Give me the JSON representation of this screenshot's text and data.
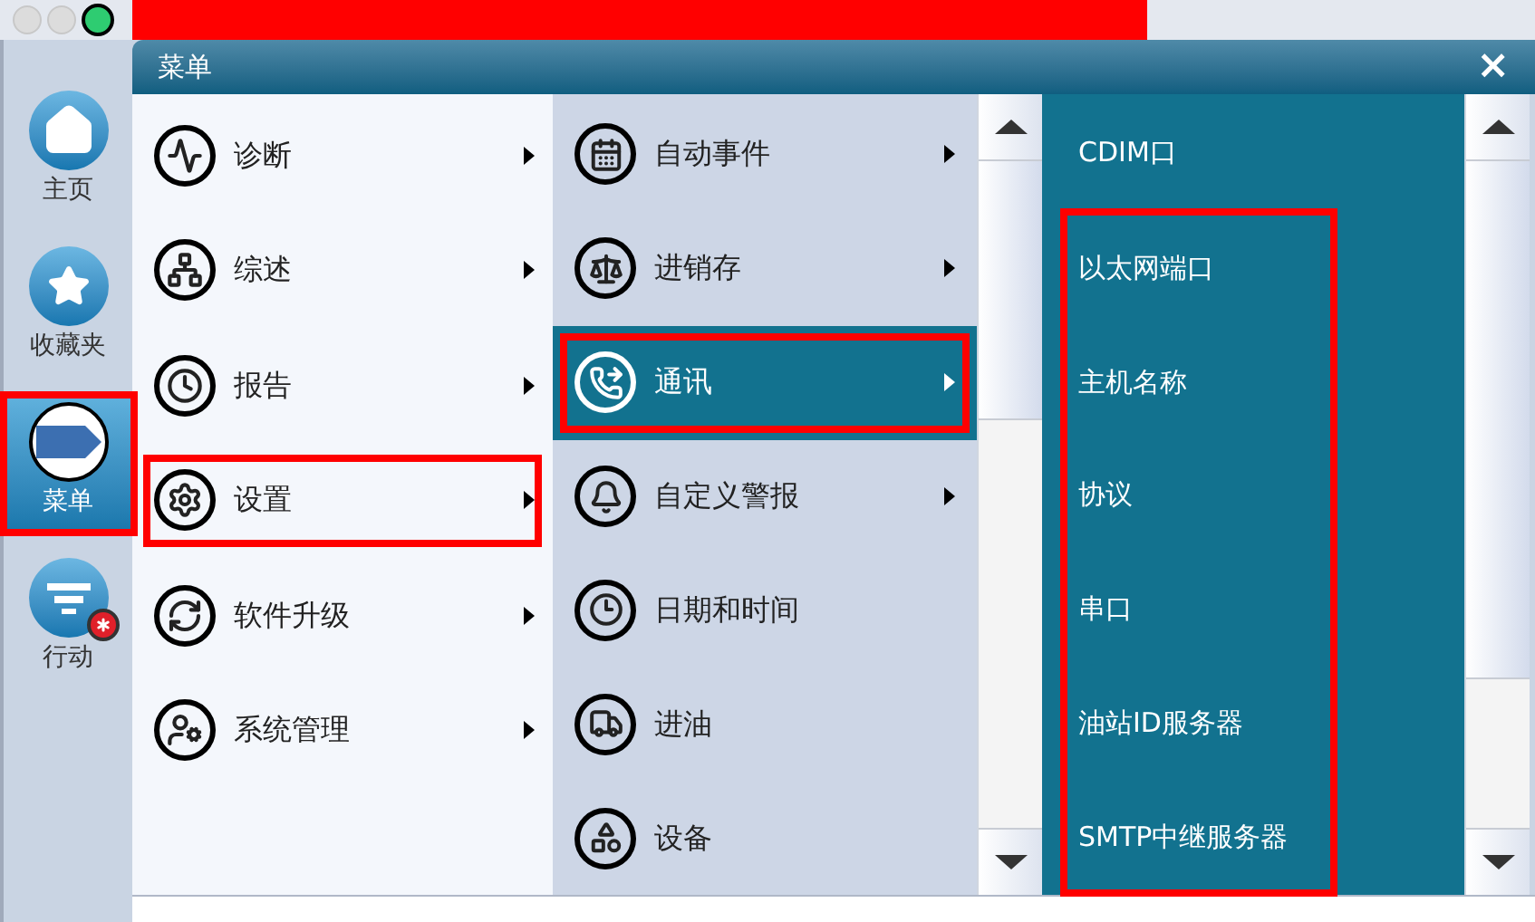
{
  "sidebar": {
    "items": [
      {
        "label": "主页",
        "selected": false,
        "highlighted": false,
        "badge": false
      },
      {
        "label": "收藏夹",
        "selected": false,
        "highlighted": false,
        "badge": false
      },
      {
        "label": "菜单",
        "selected": true,
        "highlighted": true,
        "badge": false
      },
      {
        "label": "行动",
        "selected": false,
        "highlighted": false,
        "badge": true
      }
    ]
  },
  "menu": {
    "title": "菜单",
    "close": "×",
    "column_1": [
      {
        "label": "诊断",
        "selected": false,
        "highlighted": false,
        "submenu": true
      },
      {
        "label": "综述",
        "selected": false,
        "highlighted": false,
        "submenu": true
      },
      {
        "label": "报告",
        "selected": false,
        "highlighted": false,
        "submenu": true
      },
      {
        "label": "设置",
        "selected": false,
        "highlighted": true,
        "submenu": true
      },
      {
        "label": "软件升级",
        "selected": false,
        "highlighted": false,
        "submenu": true
      },
      {
        "label": "系统管理",
        "selected": false,
        "highlighted": false,
        "submenu": true
      }
    ],
    "column_2": [
      {
        "label": "自动事件",
        "selected": false,
        "highlighted": false,
        "submenu": true
      },
      {
        "label": "进销存",
        "selected": false,
        "highlighted": false,
        "submenu": true
      },
      {
        "label": "通讯",
        "selected": true,
        "highlighted": true,
        "submenu": true
      },
      {
        "label": "自定义警报",
        "selected": false,
        "highlighted": false,
        "submenu": true
      },
      {
        "label": "日期和时间",
        "selected": false,
        "highlighted": false,
        "submenu": false
      },
      {
        "label": "进油",
        "selected": false,
        "highlighted": false,
        "submenu": false
      },
      {
        "label": "设备",
        "selected": false,
        "highlighted": false,
        "submenu": false
      }
    ],
    "column_3": [
      {
        "label": "CDIM口",
        "highlighted": false
      },
      {
        "label": "以太网端口",
        "highlighted": true
      },
      {
        "label": "主机名称",
        "highlighted": true
      },
      {
        "label": "协议",
        "highlighted": true
      },
      {
        "label": "串口",
        "highlighted": true
      },
      {
        "label": "油站ID服务器",
        "highlighted": true
      },
      {
        "label": "SMTP中继服务器",
        "highlighted": true
      }
    ]
  }
}
